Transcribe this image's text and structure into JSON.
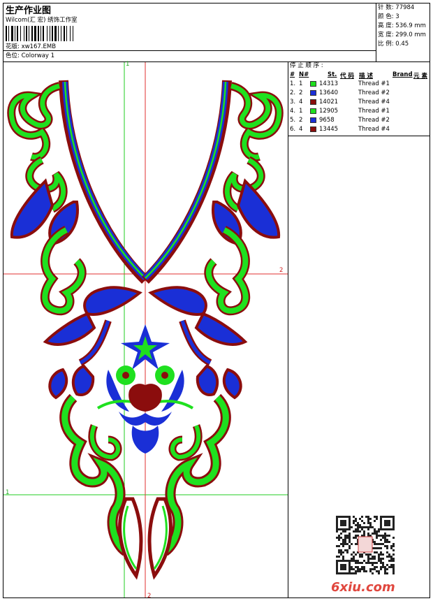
{
  "header": {
    "title": "生产作业图",
    "software": "Wilcom(汇 宏) 绣饰工作室",
    "design_label": "花版: ",
    "design_file": "xw167.EMB",
    "colorway_label": "色位: ",
    "colorway": "Colorway 1"
  },
  "stats": [
    {
      "label": "针 数: ",
      "value": "77984"
    },
    {
      "label": "颜 色: ",
      "value": "3"
    },
    {
      "label": "高 度: ",
      "value": "536.9 mm"
    },
    {
      "label": "宽 度: ",
      "value": "299.0 mm"
    },
    {
      "label": "比 例: ",
      "value": "0.45"
    }
  ],
  "stop_sequence": {
    "title": "停 止 顺 序 :",
    "columns": [
      "#",
      "N#",
      "St.",
      "代 码",
      "描 述",
      "Brand",
      "元 素"
    ],
    "rows": [
      {
        "num": "1.",
        "n": "1",
        "color": "#1fe01f",
        "code": "14313",
        "desc": "Thread #1"
      },
      {
        "num": "2.",
        "n": "2",
        "color": "#1a2fd6",
        "code": "13640",
        "desc": "Thread #2"
      },
      {
        "num": "3.",
        "n": "4",
        "color": "#8b0d0d",
        "code": "14021",
        "desc": "Thread #4"
      },
      {
        "num": "4.",
        "n": "1",
        "color": "#1fe01f",
        "code": "12905",
        "desc": "Thread #1"
      },
      {
        "num": "5.",
        "n": "2",
        "color": "#1a2fd6",
        "code": "9658",
        "desc": "Thread #2"
      },
      {
        "num": "6.",
        "n": "4",
        "color": "#8b0d0d",
        "code": "13445",
        "desc": "Thread #4"
      }
    ]
  },
  "guides": {
    "v1": "1",
    "h1": "1",
    "h2": "2",
    "v2": "2"
  },
  "colors": {
    "green": "#1fe01f",
    "blue": "#1a2fd6",
    "maroon": "#8b0d0d",
    "guide_green": "#22cc22",
    "guide_red": "#e03030"
  },
  "watermark": "6xiu.com"
}
